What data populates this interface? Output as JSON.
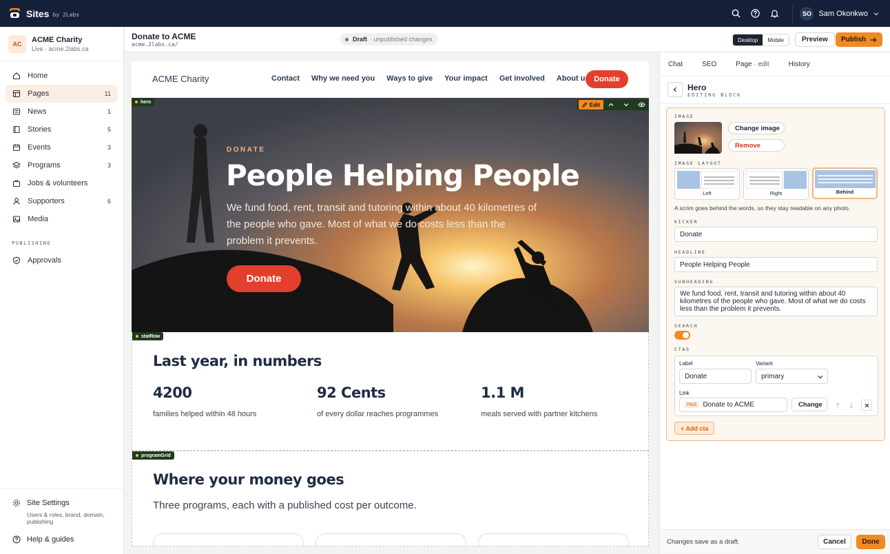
{
  "app": {
    "name": "Sites",
    "by": "by 2Labs"
  },
  "user": {
    "initials": "SO",
    "name": "Sam Okonkwo"
  },
  "org": {
    "badge": "AC",
    "name": "ACME Charity",
    "status": "Live · acme.2labs.ca"
  },
  "sidebar": {
    "items": [
      {
        "label": "Home",
        "count": "",
        "icon": "home-icon"
      },
      {
        "label": "Pages",
        "count": "11",
        "icon": "pages-icon"
      },
      {
        "label": "News",
        "count": "1",
        "icon": "news-icon"
      },
      {
        "label": "Stories",
        "count": "5",
        "icon": "book-icon"
      },
      {
        "label": "Events",
        "count": "3",
        "icon": "calendar-icon"
      },
      {
        "label": "Programs",
        "count": "3",
        "icon": "layers-icon"
      },
      {
        "label": "Jobs & volunteers",
        "count": "",
        "icon": "briefcase-icon"
      },
      {
        "label": "Supporters",
        "count": "6",
        "icon": "person-icon"
      },
      {
        "label": "Media",
        "count": "",
        "icon": "image-icon"
      }
    ],
    "publishing_label": "PUBLISHING",
    "approvals": "Approvals",
    "settings_label": "Site Settings",
    "settings_sub": "Users & roles, brand, domain, publishing",
    "help": "Help & guides"
  },
  "pagebar": {
    "title": "Donate to ACME",
    "url": "acme.2labs.ca/",
    "status": "Draft",
    "status_sub": "· unpublished changes",
    "desktop": "Desktop",
    "mobile": "Mobile",
    "preview": "Preview",
    "publish": "Publish"
  },
  "site": {
    "brand": "ACME Charity",
    "nav": [
      "Contact",
      "Why we need you",
      "Ways to give",
      "Your impact",
      "Get involved",
      "About us"
    ],
    "donate": "Donate"
  },
  "hero": {
    "tag": "hero",
    "edit": "Edit",
    "kicker": "DONATE",
    "headline": "People Helping People",
    "subheading": "We fund food, rent, transit and tutoring within about 40 kilometres of the people who gave. Most of what we do costs less than the problem it prevents.",
    "button": "Donate"
  },
  "stats": {
    "tag": "statRow",
    "heading": "Last year, in numbers",
    "items": [
      {
        "value": "4200",
        "label": "families helped within 48 hours"
      },
      {
        "value": "92 Cents",
        "label": "of every dollar reaches programmes"
      },
      {
        "value": "1.1 M",
        "label": "meals served with partner kitchens"
      }
    ]
  },
  "programs": {
    "tag": "programGrid",
    "heading": "Where your money goes",
    "subheading": "Three programs, each with a published cost per outcome."
  },
  "panel": {
    "tabs": {
      "chat": "Chat",
      "seo": "SEO",
      "page": "Page",
      "page_sub": "· edit",
      "history": "History"
    },
    "block_title": "Hero",
    "block_sub": "EDITING BLOCK",
    "image_label": "IMAGE",
    "change_image": "Change image",
    "remove": "Remove",
    "layout_label": "IMAGE LAYOUT",
    "layout_options": [
      "Left",
      "Right",
      "Behind"
    ],
    "layout_selected": "Behind",
    "layout_hint": "A scrim goes behind the words, so they stay readable on any photo.",
    "kicker_label": "KICKER",
    "kicker_value": "Donate",
    "headline_label": "HEADLINE",
    "headline_value": "People Helping People",
    "subheading_label": "SUBHEADING",
    "subheading_value": "We fund food, rent, transit and tutoring within about 40 kilometres of the people who gave. Most of what we do costs less than the problem it prevents.",
    "search_label": "SEARCH",
    "search_on": true,
    "ctas_label": "CTAS",
    "cta": {
      "label_label": "Label",
      "label_value": "Donate",
      "variant_label": "Variant",
      "variant_value": "primary",
      "link_label": "Link",
      "link_badge": "PAGE",
      "link_value": "Donate to ACME",
      "change": "Change"
    },
    "add_cta": "+ Add cta",
    "footer_text": "Changes save as a draft.",
    "cancel": "Cancel",
    "done": "Done"
  },
  "colors": {
    "accent": "#f08a24",
    "topbar": "#15213a",
    "donate": "#e2402d"
  }
}
